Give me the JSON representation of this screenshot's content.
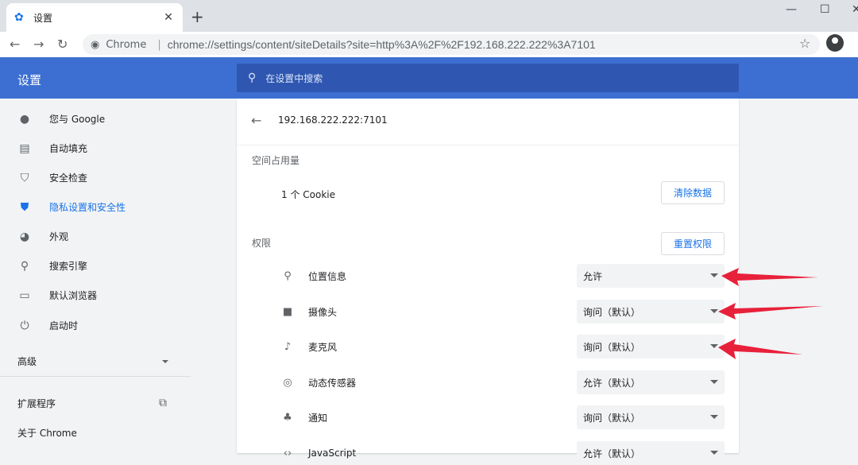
{
  "tab": {
    "title": "设置"
  },
  "toolbar": {
    "chip": "Chrome",
    "url": "chrome://settings/content/siteDetails?site=http%3A%2F%2F192.168.222.222%3A7101"
  },
  "header": {
    "title": "设置",
    "search_placeholder": "在设置中搜索"
  },
  "sidebar": {
    "items": [
      {
        "label": "您与 Google",
        "icon": "person-icon"
      },
      {
        "label": "自动填充",
        "icon": "clipboard-icon"
      },
      {
        "label": "安全检查",
        "icon": "shield-check-icon"
      },
      {
        "label": "隐私设置和安全性",
        "icon": "shield-icon"
      },
      {
        "label": "外观",
        "icon": "palette-icon"
      },
      {
        "label": "搜索引擎",
        "icon": "search-icon"
      },
      {
        "label": "默认浏览器",
        "icon": "browser-icon"
      },
      {
        "label": "启动时",
        "icon": "power-icon"
      }
    ],
    "advanced": "高级",
    "extensions": "扩展程序",
    "about": "关于 Chrome"
  },
  "site": {
    "name": "192.168.222.222:7101"
  },
  "usage": {
    "title": "空间占用量",
    "cookie": "1 个 Cookie",
    "clear_button": "清除数据"
  },
  "permissions": {
    "title": "权限",
    "reset_button": "重置权限",
    "items": [
      {
        "label": "位置信息",
        "value": "允许",
        "icon": "location-icon"
      },
      {
        "label": "摄像头",
        "value": "询问（默认）",
        "icon": "camera-icon"
      },
      {
        "label": "麦克风",
        "value": "询问（默认）",
        "icon": "mic-icon"
      },
      {
        "label": "动态传感器",
        "value": "允许（默认）",
        "icon": "sensor-icon"
      },
      {
        "label": "通知",
        "value": "询问（默认）",
        "icon": "bell-icon"
      },
      {
        "label": "JavaScript",
        "value": "允许（默认）",
        "icon": "code-icon"
      }
    ]
  },
  "annotation_color": "#e8213a"
}
